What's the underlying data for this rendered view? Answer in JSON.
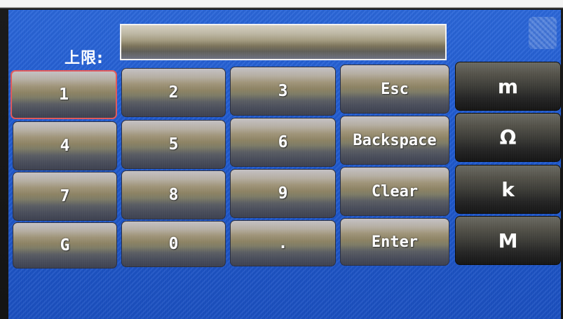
{
  "field": {
    "label": "上限:",
    "value": ""
  },
  "keys": {
    "k1": "1",
    "k2": "2",
    "k3": "3",
    "esc": "Esc",
    "milli": "m",
    "k4": "4",
    "k5": "5",
    "k6": "6",
    "backspace": "Backspace",
    "ohm": "Ω",
    "k7": "7",
    "k8": "8",
    "k9": "9",
    "clear": "Clear",
    "kilo": "k",
    "giga": "G",
    "k0": "0",
    "dot": ".",
    "enter": "Enter",
    "mega": "M"
  }
}
